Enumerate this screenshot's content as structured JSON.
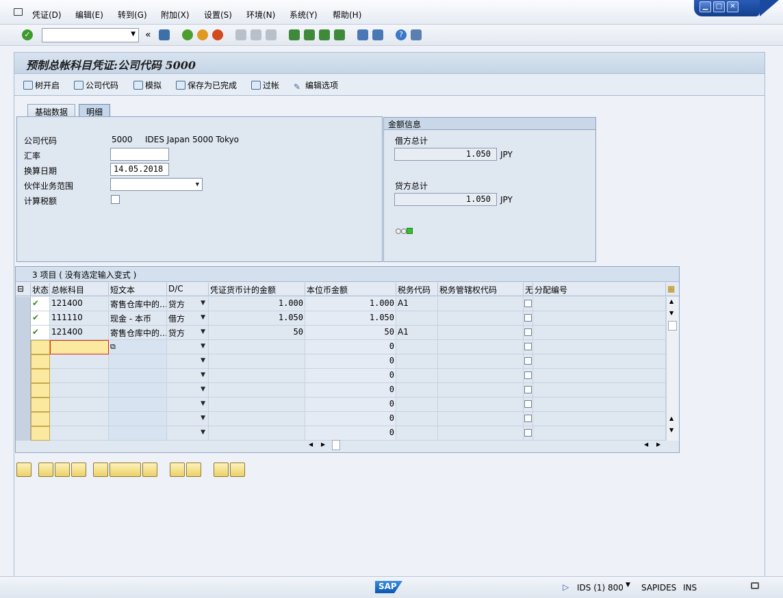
{
  "menu": [
    "凭证(D)",
    "编辑(E)",
    "转到(G)",
    "附加(X)",
    "设置(S)",
    "环境(N)",
    "系统(Y)",
    "帮助(H)"
  ],
  "title": "预制总帐科目凭证:公司代码 5000",
  "app_toolbar": {
    "tree": "树开启",
    "company": "公司代码",
    "simulate": "模拟",
    "save_complete": "保存为已完成",
    "post": "过帐",
    "edit_options": "编辑选项"
  },
  "tabs": [
    "基础数据",
    "明细"
  ],
  "header": {
    "company_label": "公司代码",
    "company_code": "5000",
    "company_name": "IDES Japan 5000 Tokyo",
    "rate_label": "汇率",
    "rate_value": "",
    "trans_date_label": "换算日期",
    "trans_date_value": "14.05.2018",
    "partner_label": "伙伴业务范围",
    "partner_value": "",
    "calc_tax_label": "计算税额"
  },
  "amount_info": {
    "title": "金额信息",
    "debit_label": "借方总计",
    "debit_value": "1.050",
    "credit_label": "贷方总计",
    "credit_value": "1.050",
    "currency": "JPY"
  },
  "table": {
    "title": "3 项目 ( 没有选定输入变式 )",
    "columns": [
      "状态",
      "总帐科目",
      "短文本",
      "D/C",
      "凭证货币计的金额",
      "本位币金额",
      "税务代码",
      "税务管辖权代码",
      "无",
      "分配编号"
    ],
    "rows": [
      {
        "account": "121400",
        "text": "寄售仓库中的…",
        "dc": "贷方",
        "doc_amount": "1.000",
        "local_amount": "1.000",
        "tax": "A1"
      },
      {
        "account": "111110",
        "text": "现金 - 本币",
        "dc": "借方",
        "doc_amount": "1.050",
        "local_amount": "1.050",
        "tax": ""
      },
      {
        "account": "121400",
        "text": "寄售仓库中的…",
        "dc": "贷方",
        "doc_amount": "50",
        "local_amount": "50",
        "tax": "A1"
      }
    ],
    "empty_local_amount": "0"
  },
  "status": {
    "system": "IDS (1) 800",
    "user": "SAPIDES",
    "mode": "INS",
    "logo": "SAP"
  }
}
